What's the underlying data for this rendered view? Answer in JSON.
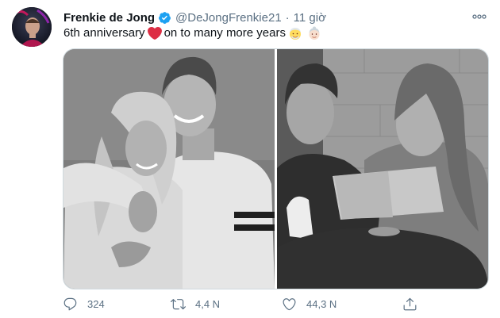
{
  "tweet": {
    "author_name": "Frenkie de Jong",
    "handle": "@DeJongFrenkie21",
    "separator": "·",
    "time": "11 giờ",
    "text_part1": "6th anniversary",
    "text_part2": "on to many more years",
    "emojis": [
      "red-heart",
      "older-man",
      "older-woman"
    ]
  },
  "actions": {
    "reply_count": "324",
    "retweet_count": "4,4 N",
    "like_count": "44,3 N"
  },
  "colors": {
    "verified": "#1da1f2",
    "secondary_text": "#5b7083",
    "heart": "#e0245e"
  }
}
